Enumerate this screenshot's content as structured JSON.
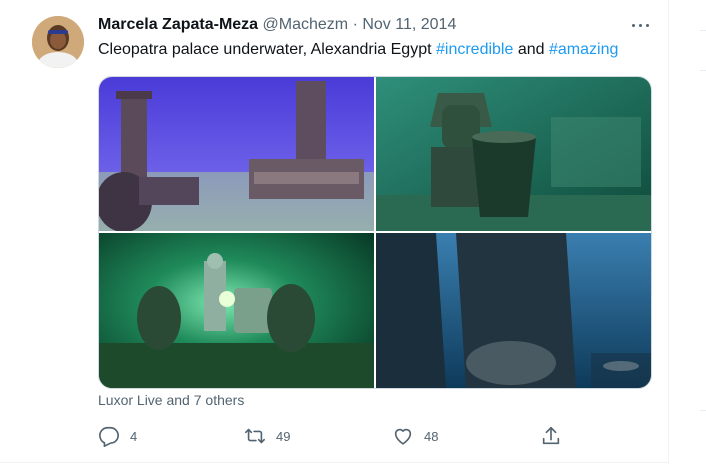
{
  "tweet": {
    "author_name": "Marcela Zapata-Meza",
    "handle": "@Machezm",
    "separator": "·",
    "date": "Nov 11, 2014",
    "text_plain": "Cleopatra palace underwater, Alexandria Egypt ",
    "hashtag1": "#incredible",
    "text_and": " and ",
    "hashtag2": "#amazing",
    "liked_by": "Luxor Live and 7 others",
    "reply_count": "4",
    "retweet_count": "49",
    "like_count": "48"
  },
  "icons": {
    "more": "more-horizontal-icon",
    "reply": "reply-icon",
    "retweet": "retweet-icon",
    "like": "heart-icon",
    "share": "share-icon"
  },
  "colors": {
    "accent": "#1d9bf0",
    "secondary_text": "#536471",
    "primary_text": "#0f1419"
  }
}
